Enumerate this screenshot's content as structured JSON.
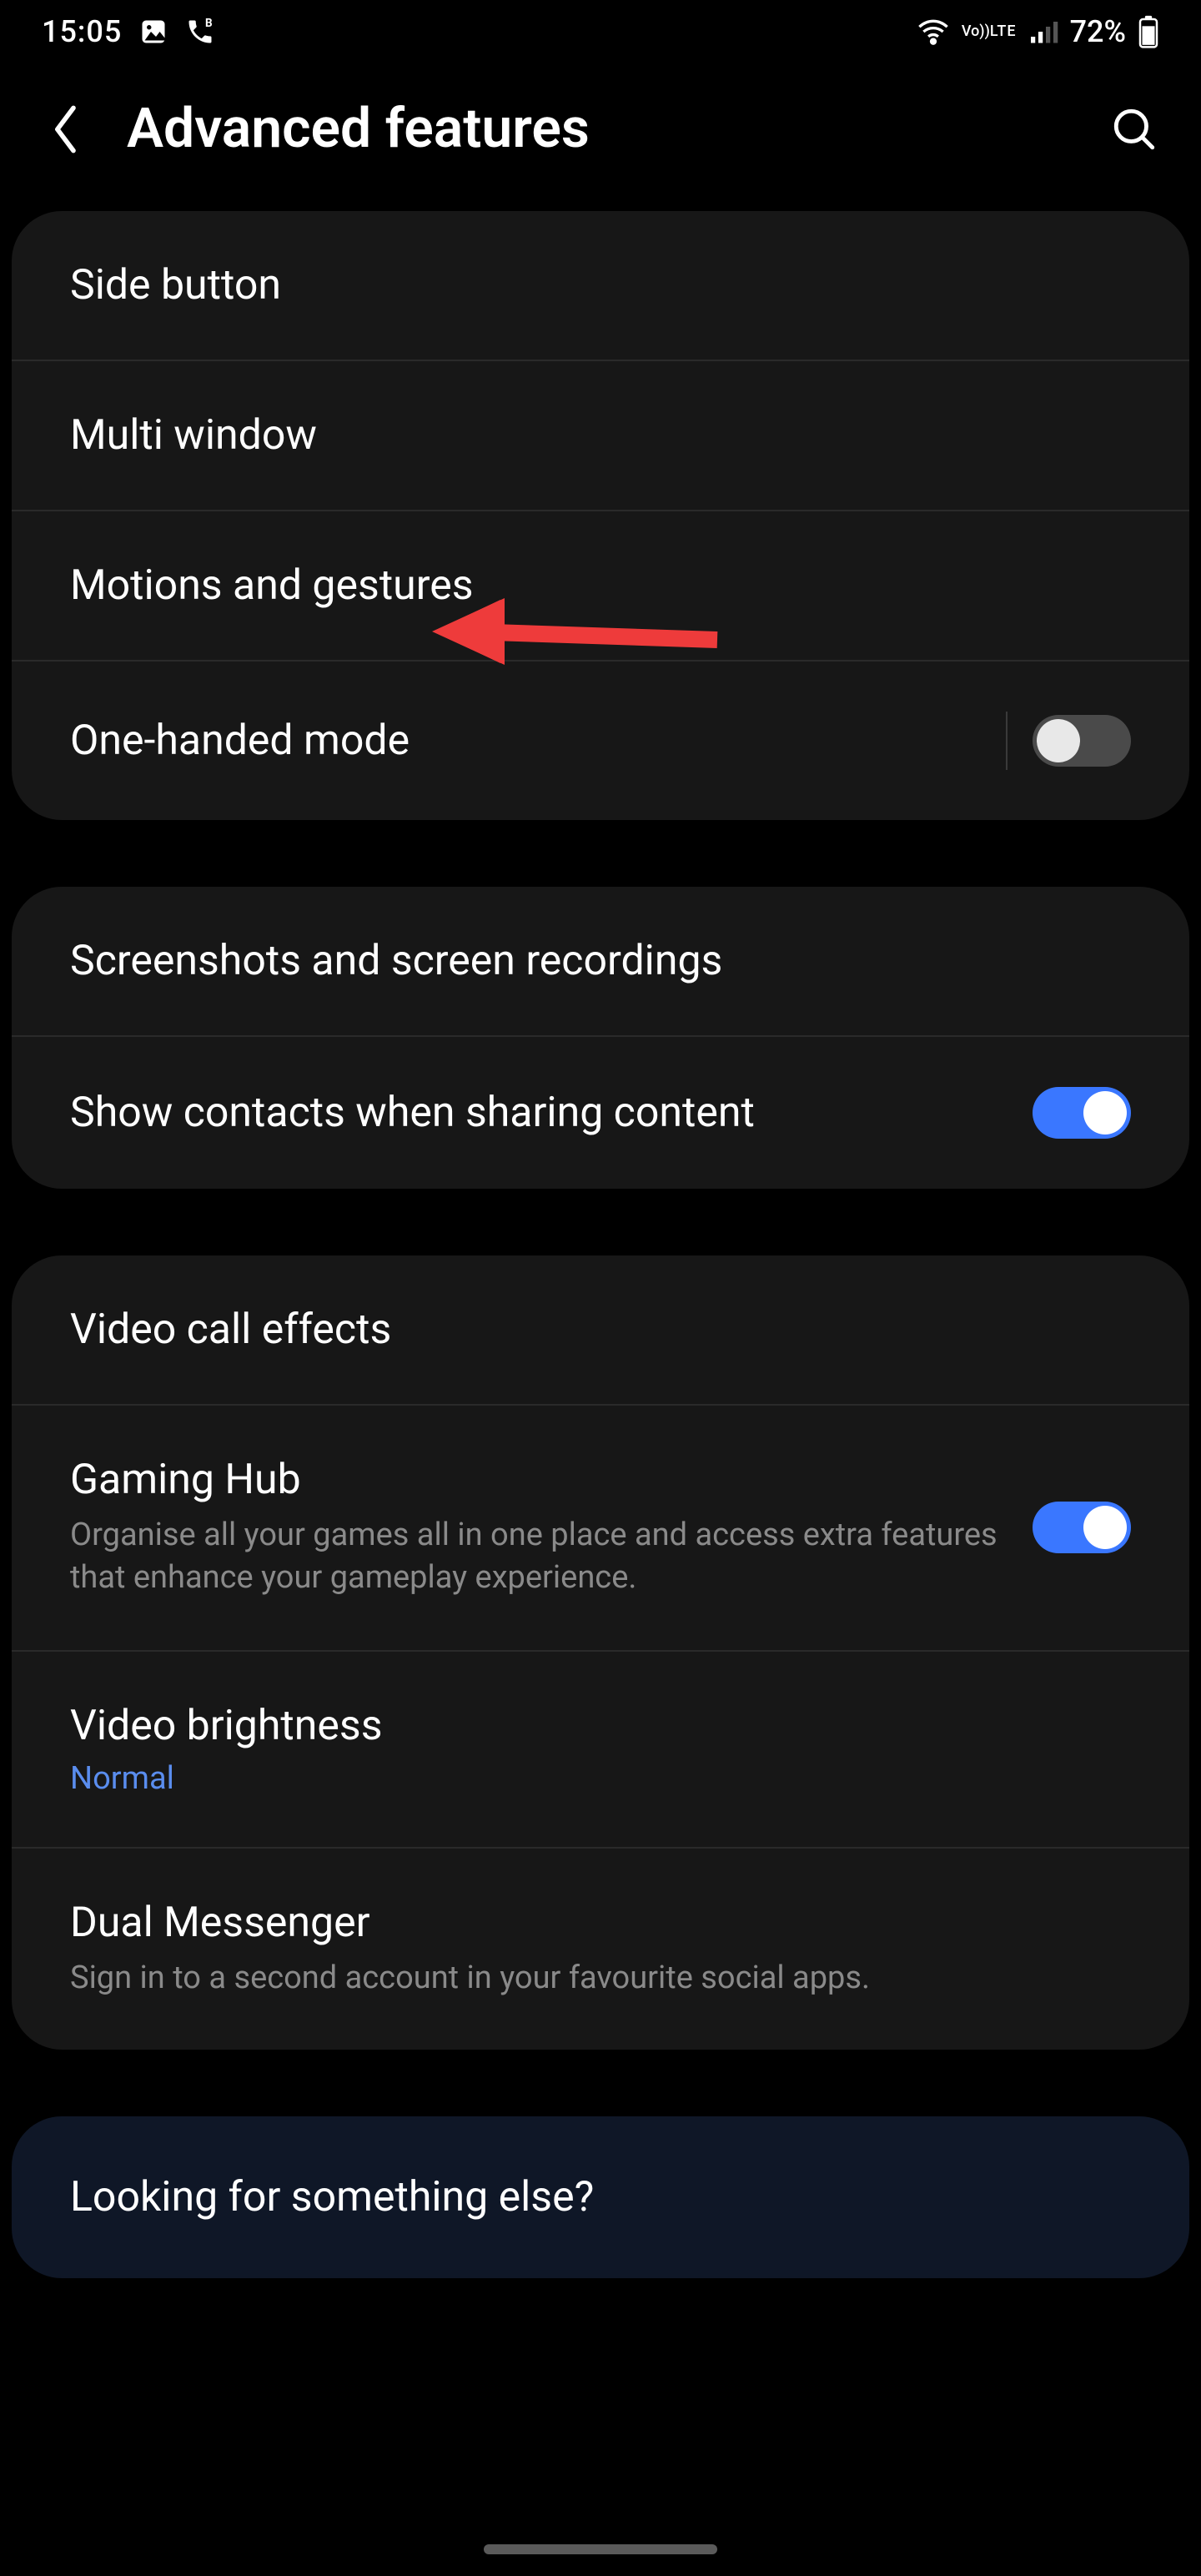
{
  "status": {
    "time": "15:05",
    "battery": "72%"
  },
  "header": {
    "title": "Advanced features"
  },
  "groups": [
    {
      "items": [
        {
          "title": "Side button"
        },
        {
          "title": "Multi window"
        },
        {
          "title": "Motions and gestures"
        },
        {
          "title": "One-handed mode",
          "toggle": false
        }
      ]
    },
    {
      "items": [
        {
          "title": "Screenshots and screen recordings"
        },
        {
          "title": "Show contacts when sharing content",
          "toggle": true
        }
      ]
    },
    {
      "items": [
        {
          "title": "Video call effects"
        },
        {
          "title": "Gaming Hub",
          "subtitle": "Organise all your games all in one place and access extra features that enhance your gameplay experience.",
          "toggle": true
        },
        {
          "title": "Video brightness",
          "value": "Normal"
        },
        {
          "title": "Dual Messenger",
          "subtitle": "Sign in to a second account in your favourite social apps."
        }
      ]
    }
  ],
  "footer": {
    "title": "Looking for something else?"
  }
}
